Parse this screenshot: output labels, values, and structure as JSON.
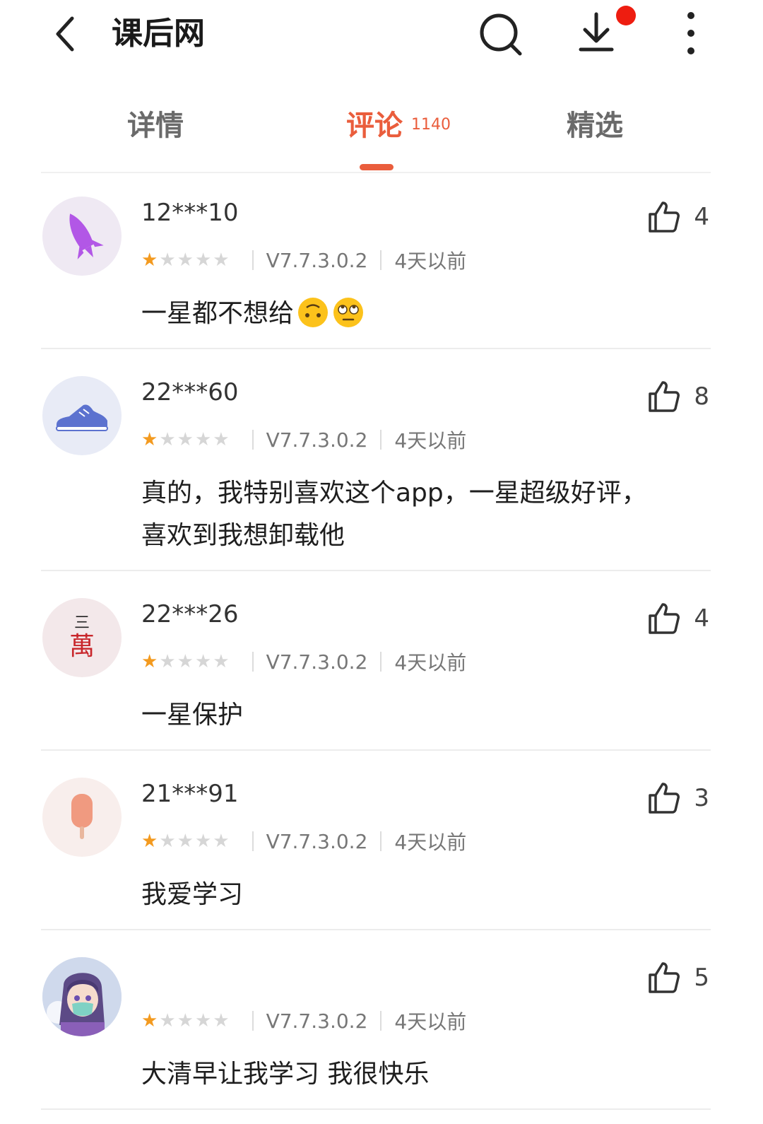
{
  "header": {
    "back_icon": "chevron-left-icon",
    "title": "课后网",
    "search_icon": "search-icon",
    "download_icon": "download-icon",
    "more_icon": "more-vertical-icon",
    "notification_color": "#ee1d10"
  },
  "tabs": [
    {
      "label": "详情",
      "active": false
    },
    {
      "label": "评论",
      "count": "1140",
      "active": true
    },
    {
      "label": "精选",
      "active": false
    }
  ],
  "accent_color": "#ea5d3c",
  "reviews": [
    {
      "username": "12***10",
      "likes": "4",
      "rating": 1,
      "version": "V7.7.3.0.2",
      "time": "4天以前",
      "text": "一星都不想给",
      "avatar": "rocket-avatar"
    },
    {
      "username": "22***60",
      "likes": "8",
      "rating": 1,
      "version": "V7.7.3.0.2",
      "time": "4天以前",
      "text_line1": "真的，我特别喜欢这个app，一星超级好评，",
      "text_line2": "喜欢到我想卸载他",
      "avatar": "sneaker-avatar"
    },
    {
      "username": "22***26",
      "likes": "4",
      "rating": 1,
      "version": "V7.7.3.0.2",
      "time": "4天以前",
      "text": "一星保护",
      "avatar": "mahjong-avatar",
      "avatar_text_top": "三",
      "avatar_text_bottom": "萬"
    },
    {
      "username": "21***91",
      "likes": "3",
      "rating": 1,
      "version": "V7.7.3.0.2",
      "time": "4天以前",
      "text": "我爱学习",
      "avatar": "popsicle-avatar"
    },
    {
      "username": "",
      "likes": "5",
      "rating": 1,
      "version": "V7.7.3.0.2",
      "time": "4天以前",
      "text": "大清早让我学习 我很快乐",
      "avatar": "anime-girl-avatar"
    }
  ]
}
